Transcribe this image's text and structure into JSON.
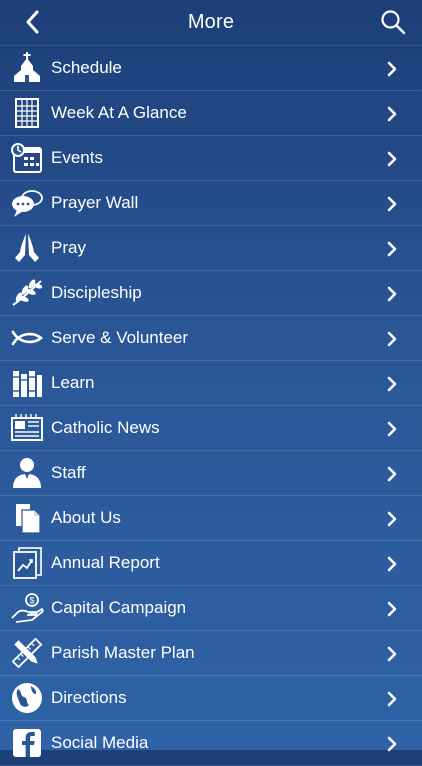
{
  "header": {
    "title": "More"
  },
  "menu": {
    "items": [
      {
        "label": "Schedule",
        "icon": "church-icon"
      },
      {
        "label": "Week At A Glance",
        "icon": "calendar-grid-icon"
      },
      {
        "label": "Events",
        "icon": "calendar-clock-icon"
      },
      {
        "label": "Prayer Wall",
        "icon": "speech-bubbles-icon"
      },
      {
        "label": "Pray",
        "icon": "praying-hands-icon"
      },
      {
        "label": "Discipleship",
        "icon": "olive-branch-icon"
      },
      {
        "label": "Serve & Volunteer",
        "icon": "fish-icon"
      },
      {
        "label": "Learn",
        "icon": "books-icon"
      },
      {
        "label": "Catholic News",
        "icon": "newspaper-icon"
      },
      {
        "label": "Staff",
        "icon": "person-icon"
      },
      {
        "label": "About Us",
        "icon": "documents-icon"
      },
      {
        "label": "Annual Report",
        "icon": "report-chart-icon"
      },
      {
        "label": "Capital Campaign",
        "icon": "hand-coin-icon"
      },
      {
        "label": "Parish Master Plan",
        "icon": "ruler-pencil-icon"
      },
      {
        "label": "Directions",
        "icon": "globe-icon"
      },
      {
        "label": "Social Media",
        "icon": "facebook-icon"
      }
    ]
  },
  "colors": {
    "background_top": "#1d3f78",
    "background_bottom": "#2f62a6",
    "text": "#ffffff"
  }
}
